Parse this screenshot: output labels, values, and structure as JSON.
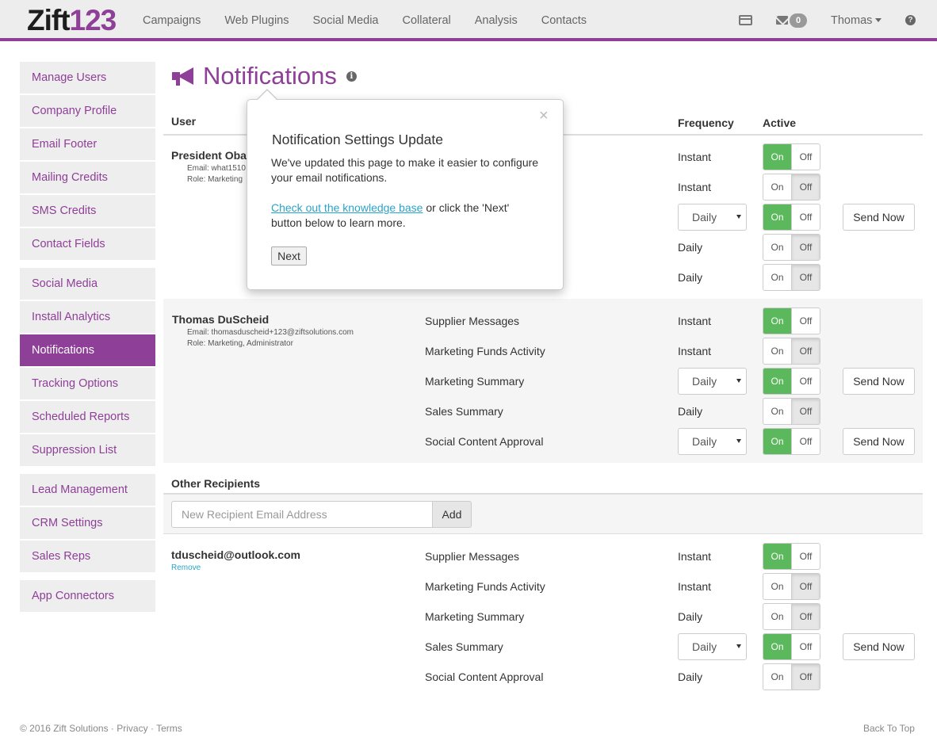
{
  "brand": {
    "part1": "Zift",
    "part2": "123"
  },
  "nav": [
    "Campaigns",
    "Web Plugins",
    "Social Media",
    "Collateral",
    "Analysis",
    "Contacts"
  ],
  "header": {
    "mail_count": "0",
    "user": "Thomas",
    "help": "?"
  },
  "sidebar": [
    "Manage Users",
    "Company Profile",
    "Email Footer",
    "Mailing Credits",
    "SMS Credits",
    "Contact Fields",
    "Social Media",
    "Install Analytics",
    "Notifications",
    "Tracking Options",
    "Scheduled Reports",
    "Suppression List",
    "Lead Management",
    "CRM Settings",
    "Sales Reps",
    "App Connectors"
  ],
  "page": {
    "title": "Notifications",
    "info": "i"
  },
  "columns": {
    "user": "User",
    "frequency": "Frequency",
    "active": "Active"
  },
  "users": [
    {
      "name": "President Oba",
      "email": "Email: what1510",
      "role": "Role: Marketing",
      "rows": [
        {
          "name": "",
          "freq": "Instant",
          "active": "on"
        },
        {
          "name": "",
          "freq": "Instant",
          "active": "off"
        },
        {
          "name": "",
          "freq": "Daily",
          "select": true,
          "active": "on",
          "send": true
        },
        {
          "name": "",
          "freq": "Daily",
          "active": "off"
        },
        {
          "name": "",
          "freq": "Daily",
          "active": "off"
        }
      ]
    },
    {
      "name": "Thomas DuScheid",
      "email": "Email: thomasduscheid+123@ziftsolutions.com",
      "role": "Role: Marketing, Administrator",
      "rows": [
        {
          "name": "Supplier Messages",
          "freq": "Instant",
          "active": "on"
        },
        {
          "name": "Marketing Funds Activity",
          "freq": "Instant",
          "active": "off"
        },
        {
          "name": "Marketing Summary",
          "freq": "Daily",
          "select": true,
          "active": "on",
          "send": true
        },
        {
          "name": "Sales Summary",
          "freq": "Daily",
          "active": "off"
        },
        {
          "name": "Social Content Approval",
          "freq": "Daily",
          "select": true,
          "active": "on",
          "send": true
        }
      ]
    }
  ],
  "other": {
    "heading": "Other Recipients",
    "placeholder": "New Recipient Email Address",
    "add": "Add",
    "recipient": {
      "email": "tduscheid@outlook.com",
      "remove": "Remove",
      "rows": [
        {
          "name": "Supplier Messages",
          "freq": "Instant",
          "active": "on"
        },
        {
          "name": "Marketing Funds Activity",
          "freq": "Instant",
          "active": "off"
        },
        {
          "name": "Marketing Summary",
          "freq": "Daily",
          "active": "off"
        },
        {
          "name": "Sales Summary",
          "freq": "Daily",
          "select": true,
          "active": "on",
          "send": true
        },
        {
          "name": "Social Content Approval",
          "freq": "Daily",
          "active": "off"
        }
      ]
    }
  },
  "labels": {
    "on": "On",
    "off": "Off",
    "send": "Send Now"
  },
  "popover": {
    "close": "×",
    "title": "Notification Settings Update",
    "line1": "We've updated this page to make it easier to configure your email notifications.",
    "link": "Check out the knowledge base",
    "line2": " or click the 'Next' button below to learn more.",
    "next": "Next"
  },
  "footer": {
    "copyright": "© 2016 Zift Solutions",
    "sep": "·",
    "privacy": "Privacy",
    "terms": "Terms",
    "back": "Back To Top"
  },
  "colors": {
    "brand": "#8e3f97",
    "on": "#5cb85c",
    "link": "#2aa4c9"
  }
}
